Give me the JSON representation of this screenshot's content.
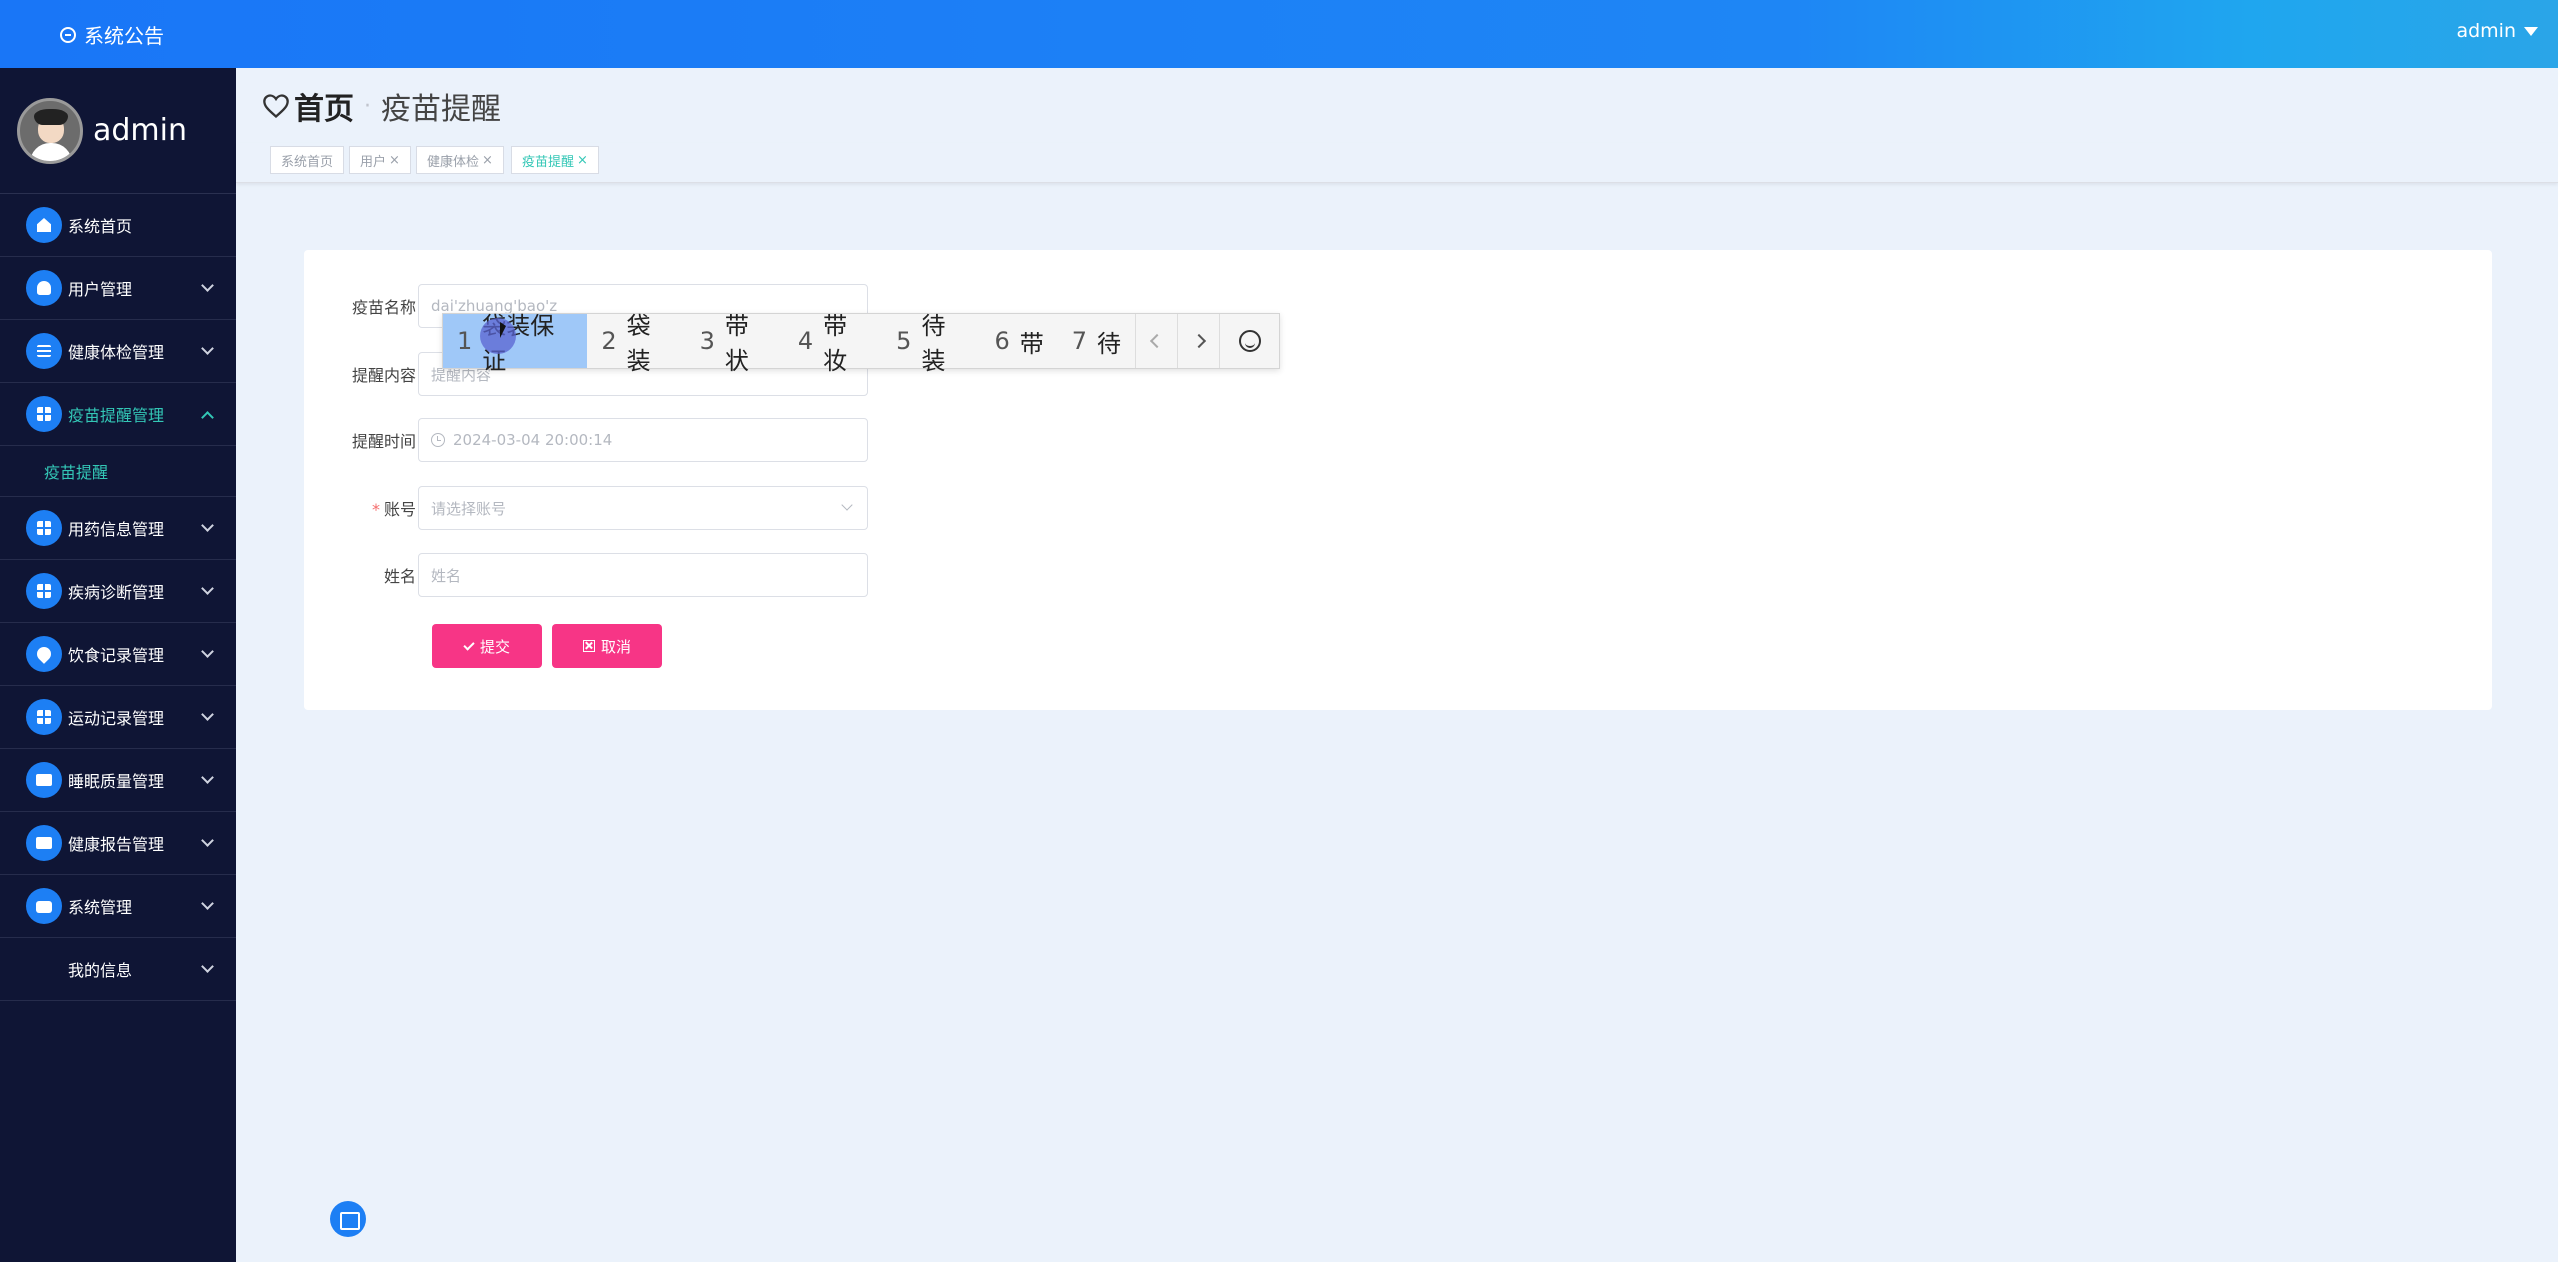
{
  "topbar": {
    "notice": "系统公告",
    "user": "admin"
  },
  "sidebar": {
    "profile_name": "admin",
    "items": [
      {
        "label": "系统首页",
        "icon": "home-icon"
      },
      {
        "label": "用户管理",
        "icon": "user-icon"
      },
      {
        "label": "健康体检管理",
        "icon": "list-icon"
      },
      {
        "label": "疫苗提醒管理",
        "icon": "grid-icon"
      },
      {
        "label": "用药信息管理",
        "icon": "grid-icon"
      },
      {
        "label": "疾病诊断管理",
        "icon": "grid-icon"
      },
      {
        "label": "饮食记录管理",
        "icon": "pin-icon"
      },
      {
        "label": "运动记录管理",
        "icon": "grid-icon"
      },
      {
        "label": "睡眠质量管理",
        "icon": "ticket-icon"
      },
      {
        "label": "健康报告管理",
        "icon": "doc-icon"
      },
      {
        "label": "系统管理",
        "icon": "briefcase-icon"
      },
      {
        "label": "我的信息",
        "icon": "card-icon"
      }
    ],
    "sub_item": "疫苗提醒"
  },
  "breadcrumb": {
    "home": "首页",
    "current": "疫苗提醒"
  },
  "tags": [
    {
      "label": "系统首页"
    },
    {
      "label": "用户"
    },
    {
      "label": "健康体检"
    },
    {
      "label": "疫苗提醒"
    }
  ],
  "form": {
    "vaccine_name_label": "疫苗名称",
    "vaccine_name_value": "dai'zhuang'bao'z",
    "content_label": "提醒内容",
    "content_placeholder": "提醒内容",
    "time_label": "提醒时间",
    "time_value": "2024-03-04 20:00:14",
    "account_label": "账号",
    "account_placeholder": "请选择账号",
    "name_label": "姓名",
    "name_placeholder": "姓名",
    "submit_label": "提交",
    "cancel_label": "取消"
  },
  "ime": {
    "candidates": [
      {
        "num": "1",
        "text": "袋装保证"
      },
      {
        "num": "2",
        "text": "袋装"
      },
      {
        "num": "3",
        "text": "带状"
      },
      {
        "num": "4",
        "text": "带妆"
      },
      {
        "num": "5",
        "text": "待装"
      },
      {
        "num": "6",
        "text": "带"
      },
      {
        "num": "7",
        "text": "待"
      }
    ]
  },
  "colors": {
    "accent": "#1d7ff4",
    "active": "#33c7b6",
    "button": "#f73586",
    "sidebar": "#0f1535"
  }
}
